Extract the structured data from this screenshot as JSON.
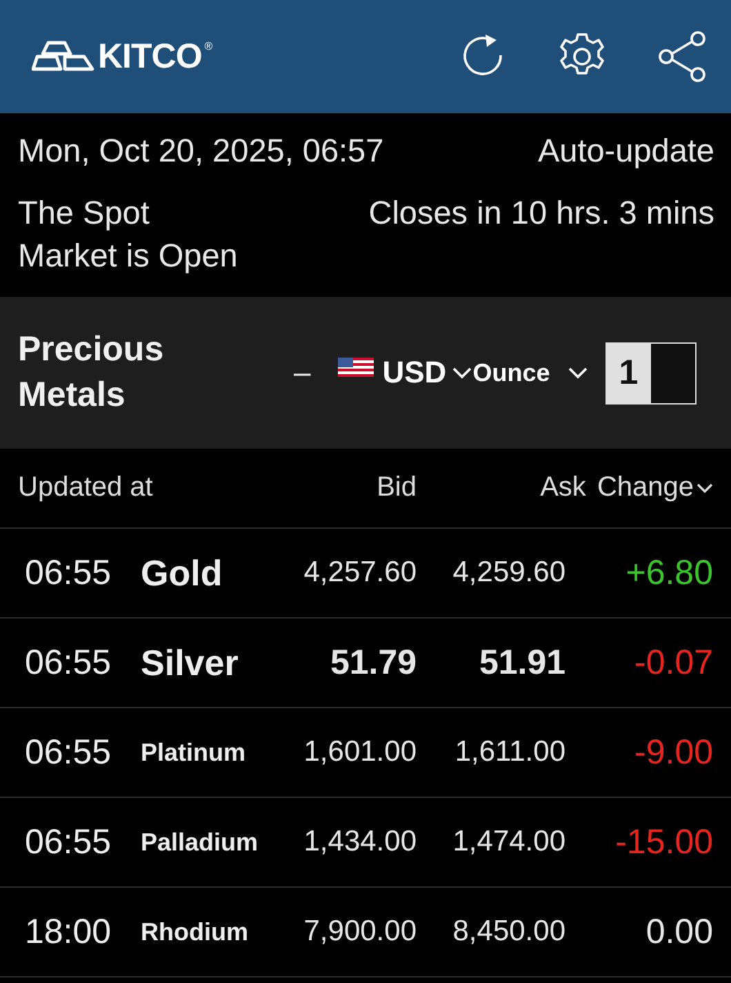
{
  "header": {
    "logo": "KITCO",
    "mark": "®"
  },
  "info": {
    "datetime": "Mon, Oct 20, 2025, 06:57",
    "auto_update": "Auto-update",
    "market_status": "The Spot Market is Open",
    "closes": "Closes in 10 hrs. 3 mins"
  },
  "section": {
    "title": "Precious Metals",
    "dash": "–",
    "currency": "USD",
    "unit": "Ounce",
    "segments": [
      {
        "label": "1",
        "selected": true
      },
      {
        "selected": false
      }
    ]
  },
  "table": {
    "columns": [
      "Updated at",
      "Bid",
      "Ask",
      "Change"
    ],
    "rows": [
      {
        "time": "06:55",
        "name": "Gold",
        "bid": "4,257.60",
        "ask": "4,259.60",
        "change": "+6.80",
        "color": "#3cc42e"
      },
      {
        "time": "06:55",
        "name": "Silver",
        "bid": "51.79",
        "ask": "51.91",
        "change": "-0.07",
        "color": "#e8241f"
      },
      {
        "time": "06:55",
        "name": "Platinum",
        "bid": "1,601.00",
        "ask": "1,611.00",
        "change": "-9.00",
        "color": "#e8241f"
      },
      {
        "time": "06:55",
        "name": "Palladium",
        "bid": "1,434.00",
        "ask": "1,474.00",
        "change": "-15.00",
        "color": "#e8241f"
      },
      {
        "time": "18:00",
        "name": "Rhodium",
        "bid": "7,900.00",
        "ask": "8,450.00",
        "change": "0.00",
        "color": "#e6e6e6"
      }
    ]
  }
}
